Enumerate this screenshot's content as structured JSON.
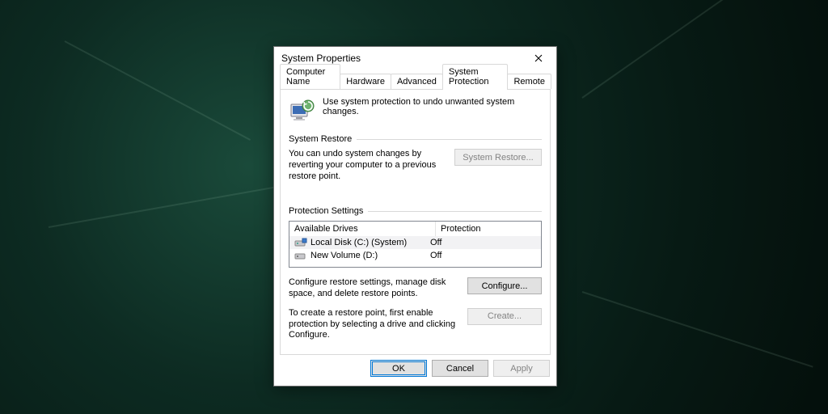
{
  "dialog": {
    "title": "System Properties",
    "tabs": [
      "Computer Name",
      "Hardware",
      "Advanced",
      "System Protection",
      "Remote"
    ],
    "active_tab": "System Protection",
    "info_text": "Use system protection to undo unwanted system changes.",
    "group1": {
      "title": "System Restore",
      "text": "You can undo system changes by reverting your computer to a previous restore point.",
      "button": "System Restore..."
    },
    "group2": {
      "title": "Protection Settings",
      "columns": [
        "Available Drives",
        "Protection"
      ],
      "drives": [
        {
          "name": "Local Disk (C:) (System)",
          "protection": "Off"
        },
        {
          "name": "New Volume (D:)",
          "protection": "Off"
        }
      ],
      "configure_text": "Configure restore settings, manage disk space, and delete restore points.",
      "configure_button": "Configure...",
      "create_text": "To create a restore point, first enable protection by selecting a drive and clicking Configure.",
      "create_button": "Create..."
    },
    "buttons": {
      "ok": "OK",
      "cancel": "Cancel",
      "apply": "Apply"
    }
  }
}
